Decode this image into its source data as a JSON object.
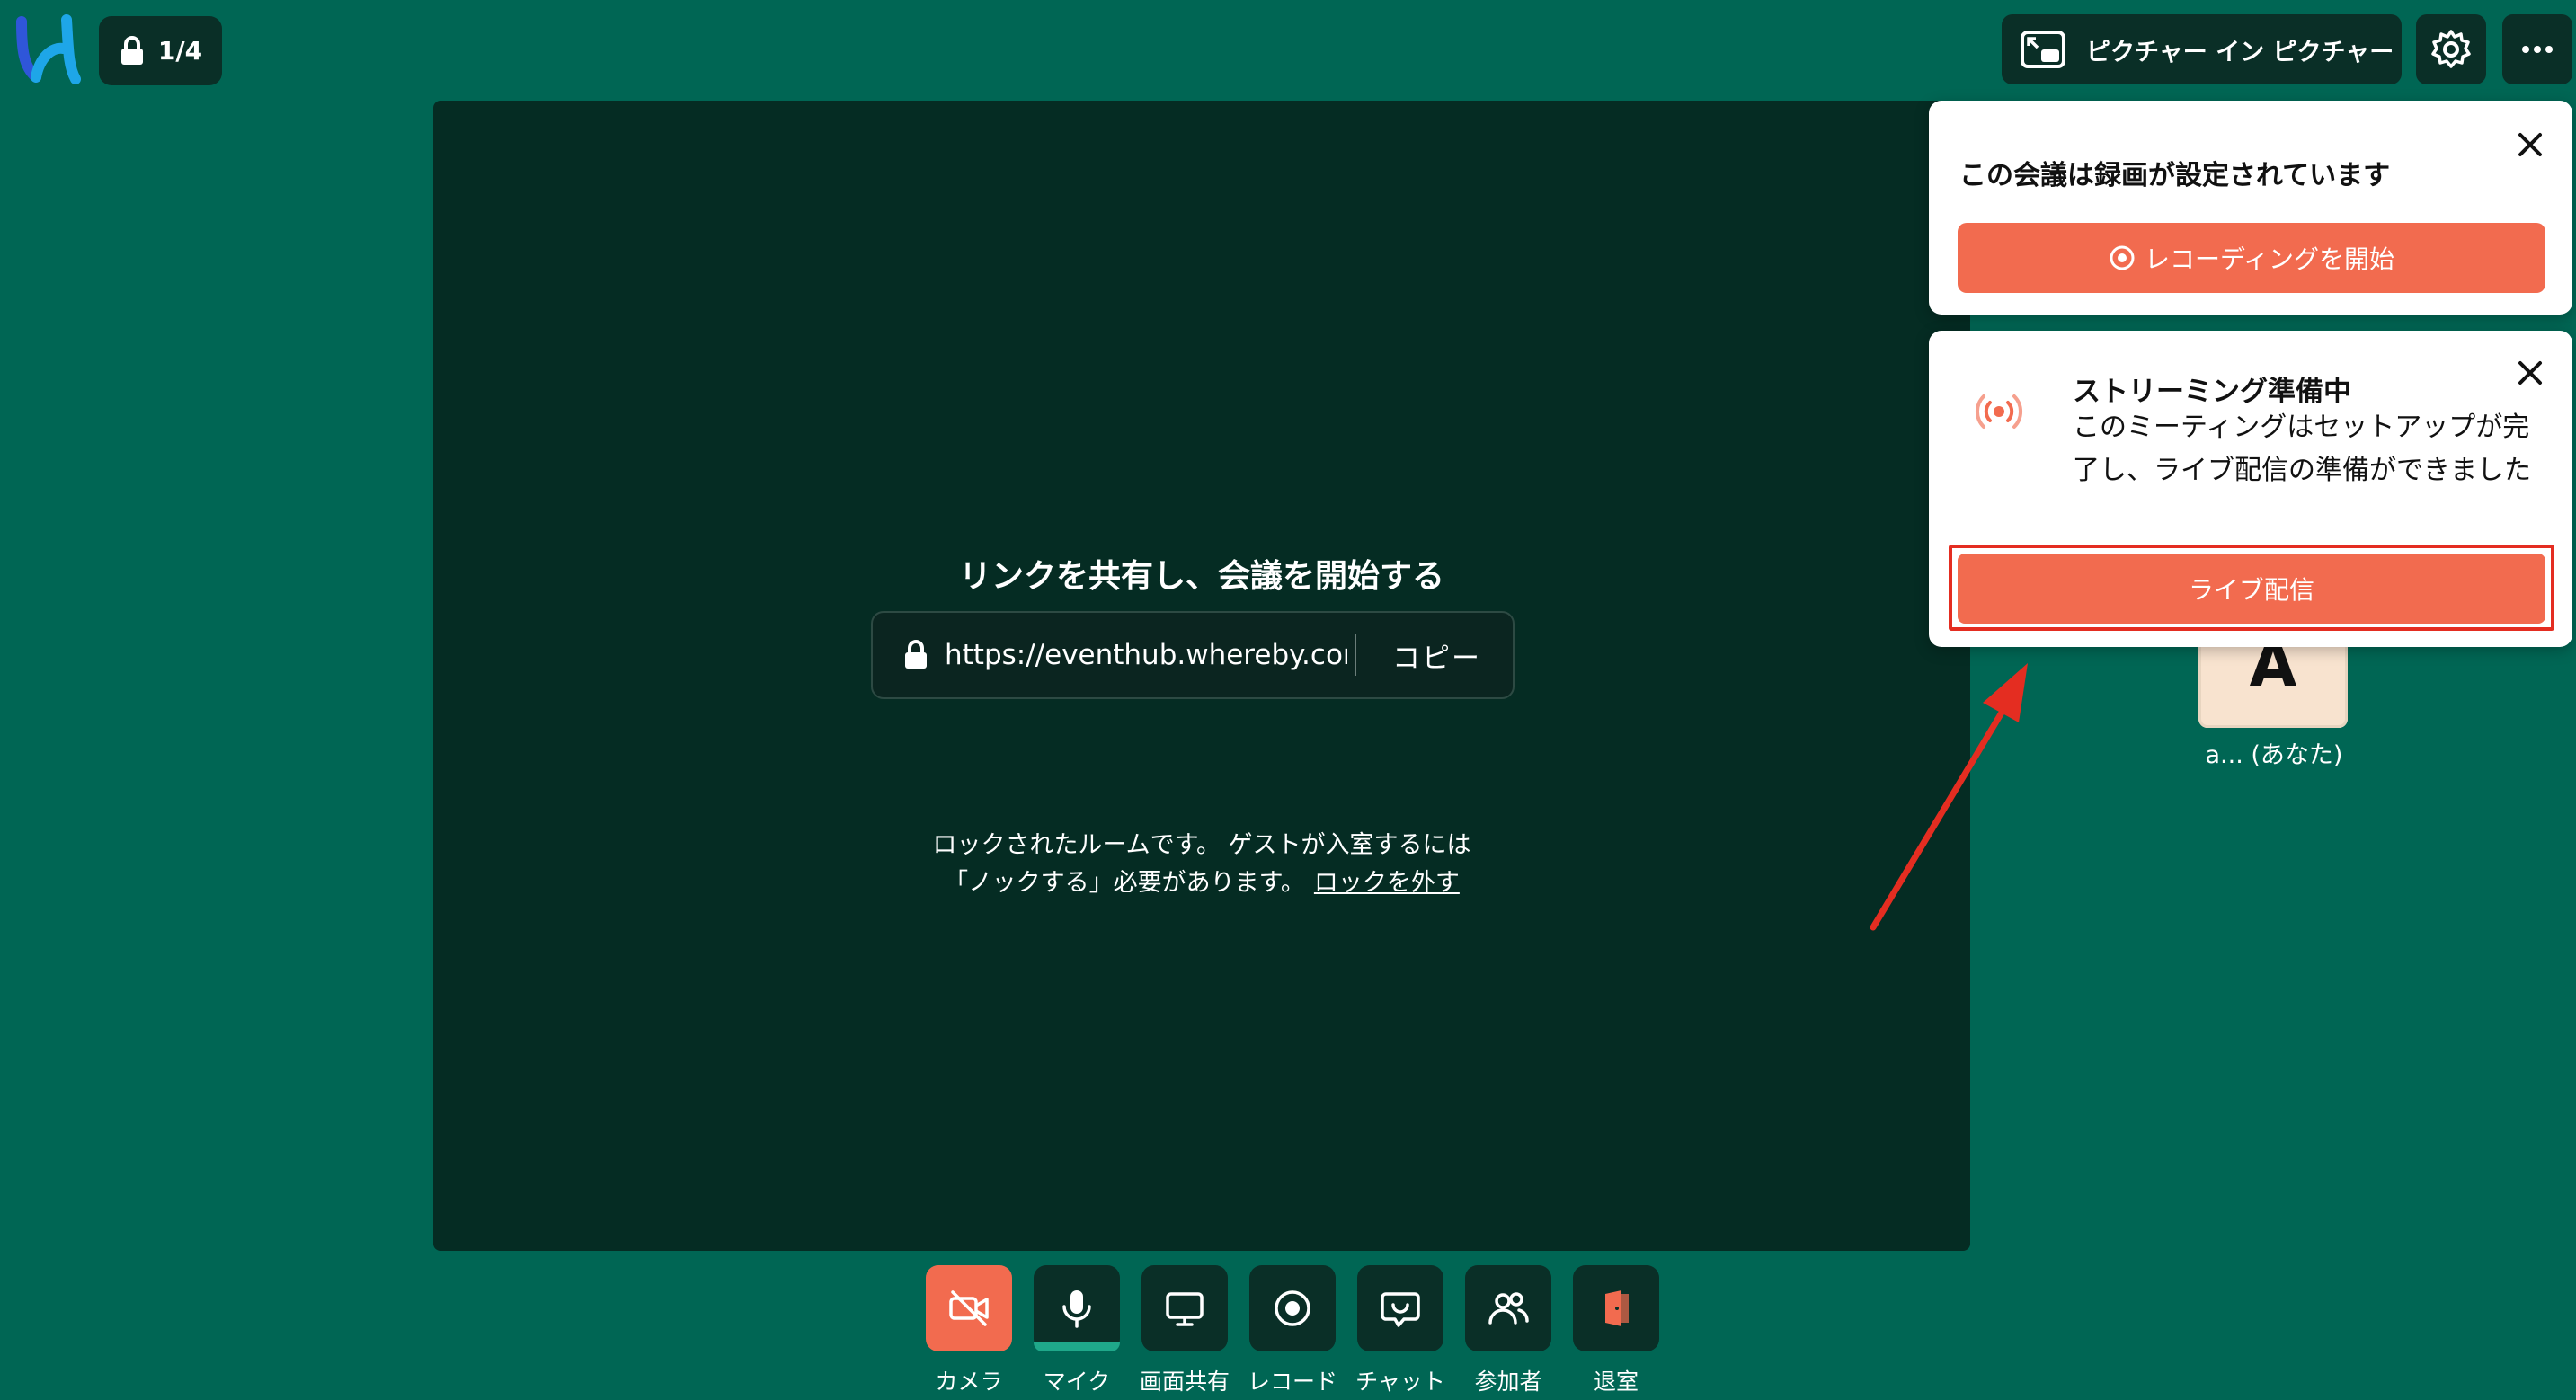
{
  "header": {
    "room_lock_count": "1/4",
    "pip_label": "ピクチャー イン ピクチャー",
    "icons": [
      "logo",
      "lock-icon",
      "picture-in-picture-icon",
      "gear-icon",
      "more-icon"
    ]
  },
  "stage": {
    "title": "リンクを共有し、会議を開始する",
    "url": "https://eventhub.whereby.com/v",
    "copy_label": "コピー",
    "lock_note_line1": "ロックされたルームです。 ゲストが入室するには",
    "lock_note_line2": "「ノックする」必要があります。",
    "unlock_link": "ロックを外す"
  },
  "participant": {
    "initial": "A",
    "name": "a... (あなた)"
  },
  "recording_card": {
    "title": "この会議は録画が設定されています",
    "button_label": "レコーディングを開始"
  },
  "streaming_card": {
    "title": "ストリーミング準備中",
    "body": "このミーティングはセットアップが完了し、ライブ配信の準備ができました",
    "button_label": "ライブ配信"
  },
  "toolbar": {
    "items": [
      {
        "label": "カメラ",
        "icon": "camera-off-icon"
      },
      {
        "label": "マイク",
        "icon": "mic-icon"
      },
      {
        "label": "画面共有",
        "icon": "screen-share-icon"
      },
      {
        "label": "レコード",
        "icon": "record-icon"
      },
      {
        "label": "チャット",
        "icon": "chat-icon"
      },
      {
        "label": "参加者",
        "icon": "people-icon"
      },
      {
        "label": "退室",
        "icon": "leave-icon"
      }
    ]
  },
  "colors": {
    "background": "#006654",
    "stage": "#052c23",
    "accent": "#f26b4f",
    "highlight": "#e42d21"
  }
}
